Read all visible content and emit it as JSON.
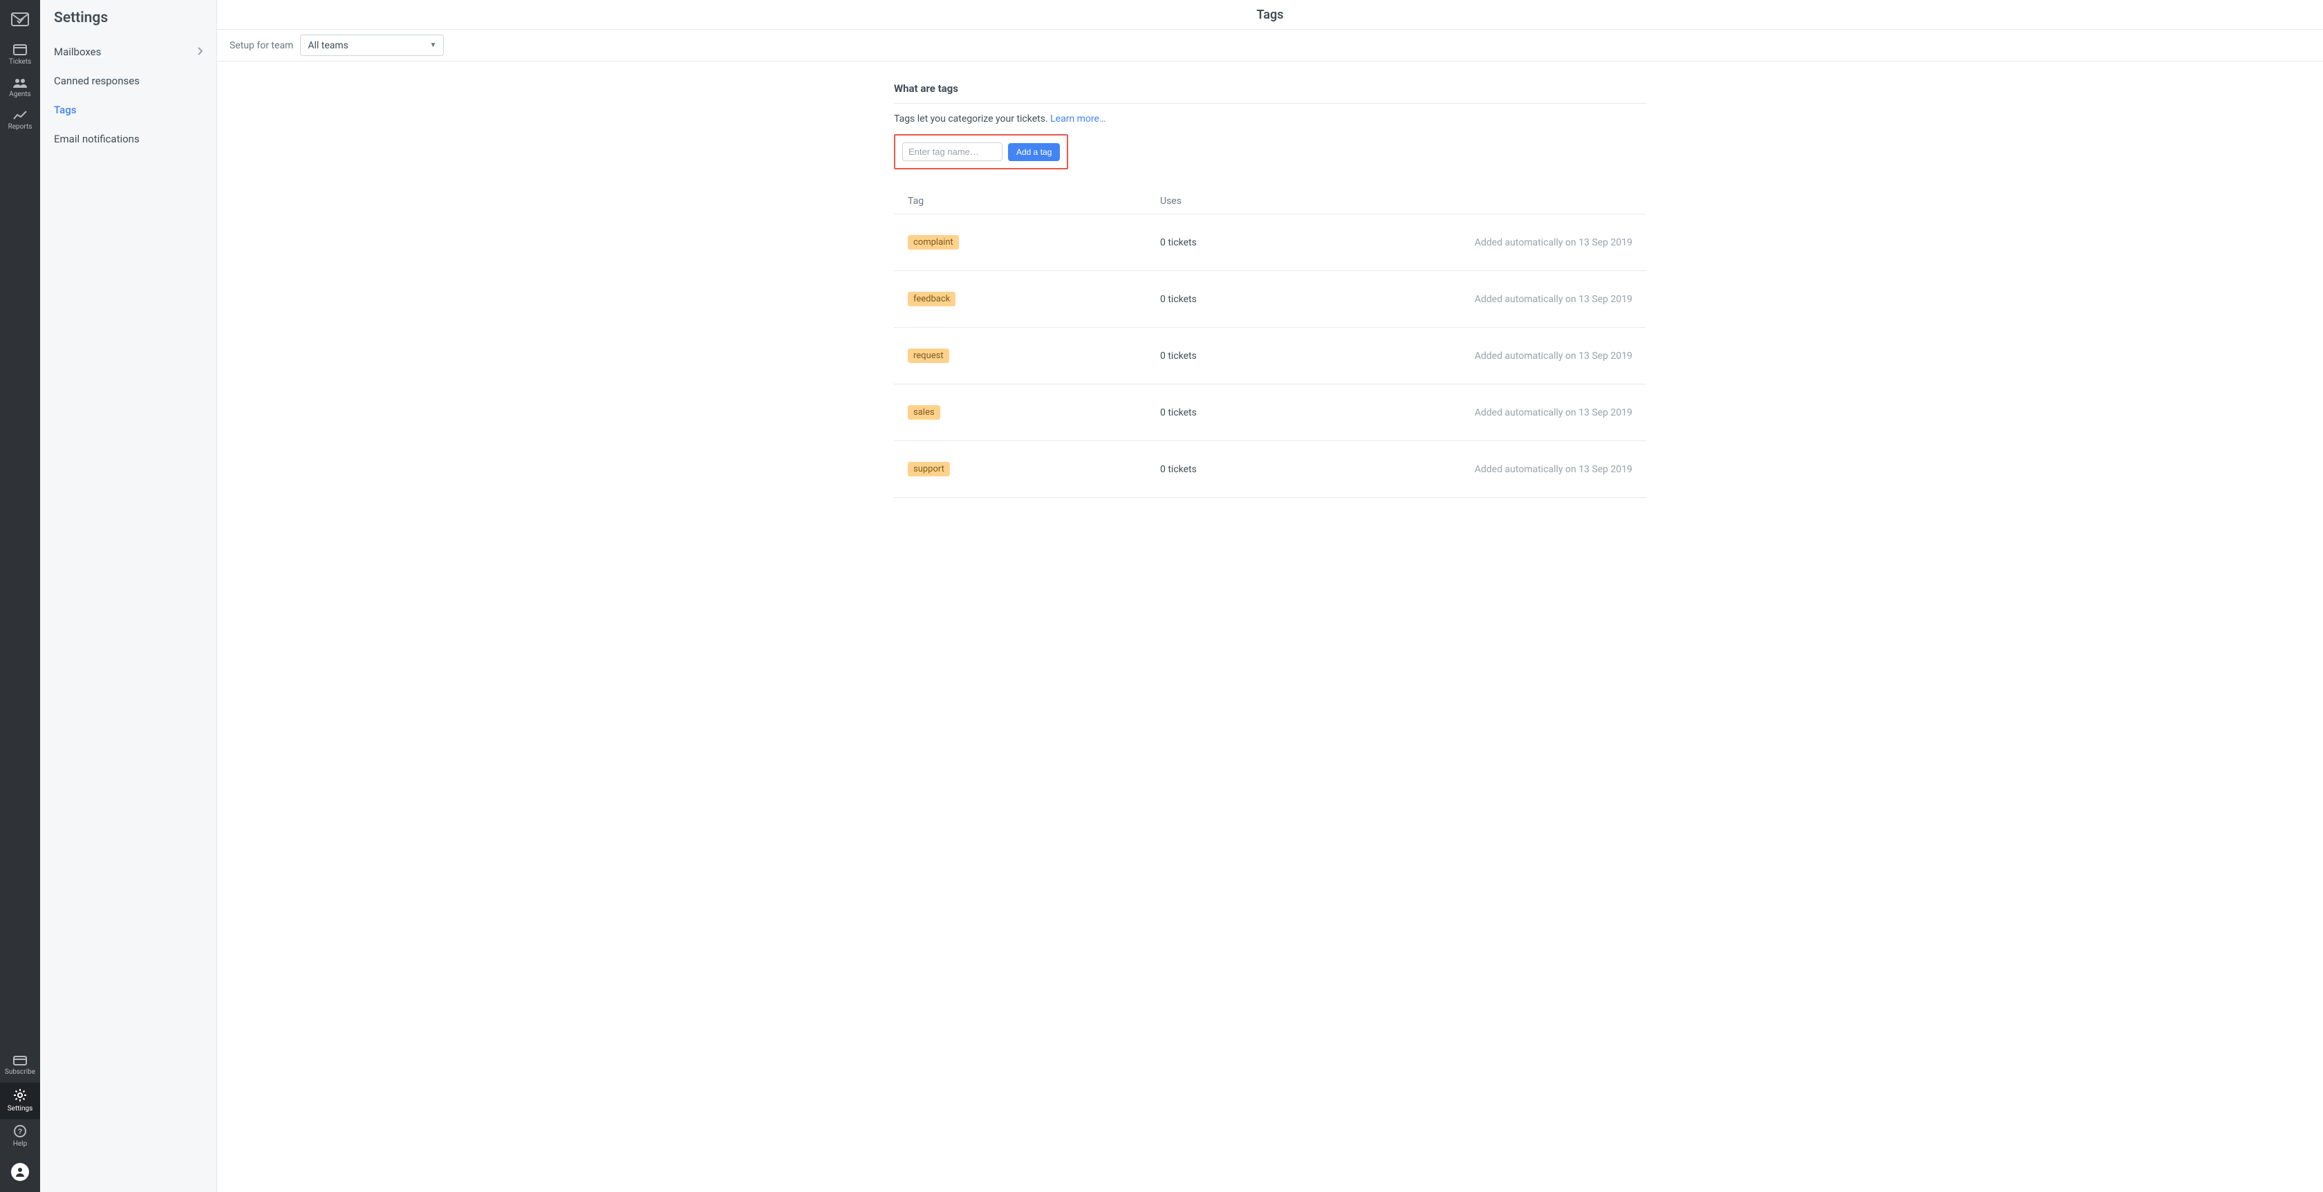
{
  "rail": {
    "items": [
      {
        "key": "tickets",
        "label": "Tickets"
      },
      {
        "key": "agents",
        "label": "Agents"
      },
      {
        "key": "reports",
        "label": "Reports"
      }
    ],
    "bottom": [
      {
        "key": "subscribe",
        "label": "Subscribe"
      },
      {
        "key": "settings",
        "label": "Settings",
        "active": true
      },
      {
        "key": "help",
        "label": "Help"
      }
    ]
  },
  "submenu": {
    "title": "Settings",
    "items": [
      {
        "label": "Mailboxes",
        "chevron": true
      },
      {
        "label": "Canned responses"
      },
      {
        "label": "Tags",
        "active": true
      },
      {
        "label": "Email notifications"
      }
    ]
  },
  "page": {
    "title": "Tags",
    "filter_label": "Setup for team",
    "team_selected": "All teams",
    "heading": "What are tags",
    "description": "Tags let you categorize your tickets. ",
    "learn_more": "Learn more…",
    "input_placeholder": "Enter tag name…",
    "add_button": "Add a tag",
    "columns": {
      "tag": "Tag",
      "uses": "Uses"
    },
    "rows": [
      {
        "name": "complaint",
        "uses": "0 tickets",
        "note": "Added automatically on 13 Sep 2019"
      },
      {
        "name": "feedback",
        "uses": "0 tickets",
        "note": "Added automatically on 13 Sep 2019"
      },
      {
        "name": "request",
        "uses": "0 tickets",
        "note": "Added automatically on 13 Sep 2019"
      },
      {
        "name": "sales",
        "uses": "0 tickets",
        "note": "Added automatically on 13 Sep 2019"
      },
      {
        "name": "support",
        "uses": "0 tickets",
        "note": "Added automatically on 13 Sep 2019"
      }
    ]
  }
}
